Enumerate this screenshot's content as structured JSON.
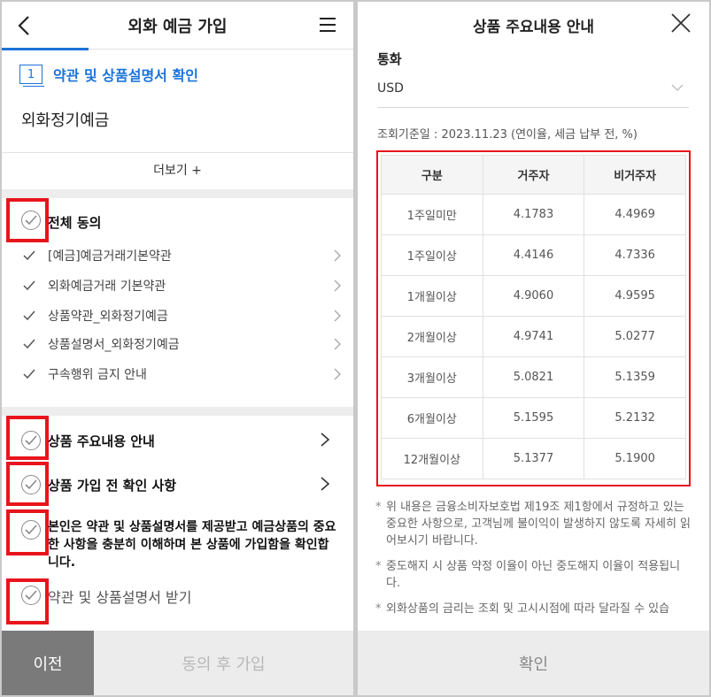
{
  "left": {
    "header": {
      "title": "외화 예금 가입"
    },
    "step": {
      "number": "1",
      "label": "약관 및 상품설명서 확인"
    },
    "product_name": "외화정기예금",
    "more_label": "더보기 +",
    "all_agree_label": "전체 동의",
    "sub_items": [
      {
        "label": "[예금]예금거래기본약관"
      },
      {
        "label": "외화예금거래 기본약관"
      },
      {
        "label": "상품약관_외화정기예금"
      },
      {
        "label": "상품설명서_외화정기예금"
      },
      {
        "label": "구속행위 금지 안내"
      }
    ],
    "main_items": [
      {
        "label": "상품 주요내용 안내"
      },
      {
        "label": "상품 가입 전 확인 사항"
      }
    ],
    "consent_text": "본인은 약관 및 상품설명서를 제공받고 예금상품의 중요한 사항을 충분히 이해하며 본 상품에 가입함을 확인합니다.",
    "receive_label": "약관 및 상품설명서 받기",
    "buttons": {
      "prev": "이전",
      "next": "동의 후 가입"
    }
  },
  "right": {
    "header": {
      "title": "상품 주요내용 안내"
    },
    "currency_label": "통화",
    "currency_value": "USD",
    "ref_date": "조회기준일 : 2023.11.23 (연이율, 세금 납부 전, %)",
    "table": {
      "headers": [
        "구분",
        "거주자",
        "비거주자"
      ],
      "rows": [
        [
          "1주일미만",
          "4.1783",
          "4.4969"
        ],
        [
          "1주일이상",
          "4.4146",
          "4.7336"
        ],
        [
          "1개월이상",
          "4.9060",
          "4.9595"
        ],
        [
          "2개월이상",
          "4.9741",
          "5.0277"
        ],
        [
          "3개월이상",
          "5.0821",
          "5.1359"
        ],
        [
          "6개월이상",
          "5.1595",
          "5.2132"
        ],
        [
          "12개월이상",
          "5.1377",
          "5.1900"
        ]
      ]
    },
    "notes": [
      "위 내용은 금융소비자보호법 제19조 제1항에서 규정하고 있는 중요한 사항으로, 고객님께 불이익이 발생하지 않도록 자세히 읽어보시기 바랍니다.",
      "중도해지 시 상품 약정 이율이 아닌 중도해지 이율이 적용됩니다.",
      "외화상품의 금리는 조회 및 고시시점에 따라 달라질 수 있습"
    ],
    "confirm_label": "확인"
  }
}
